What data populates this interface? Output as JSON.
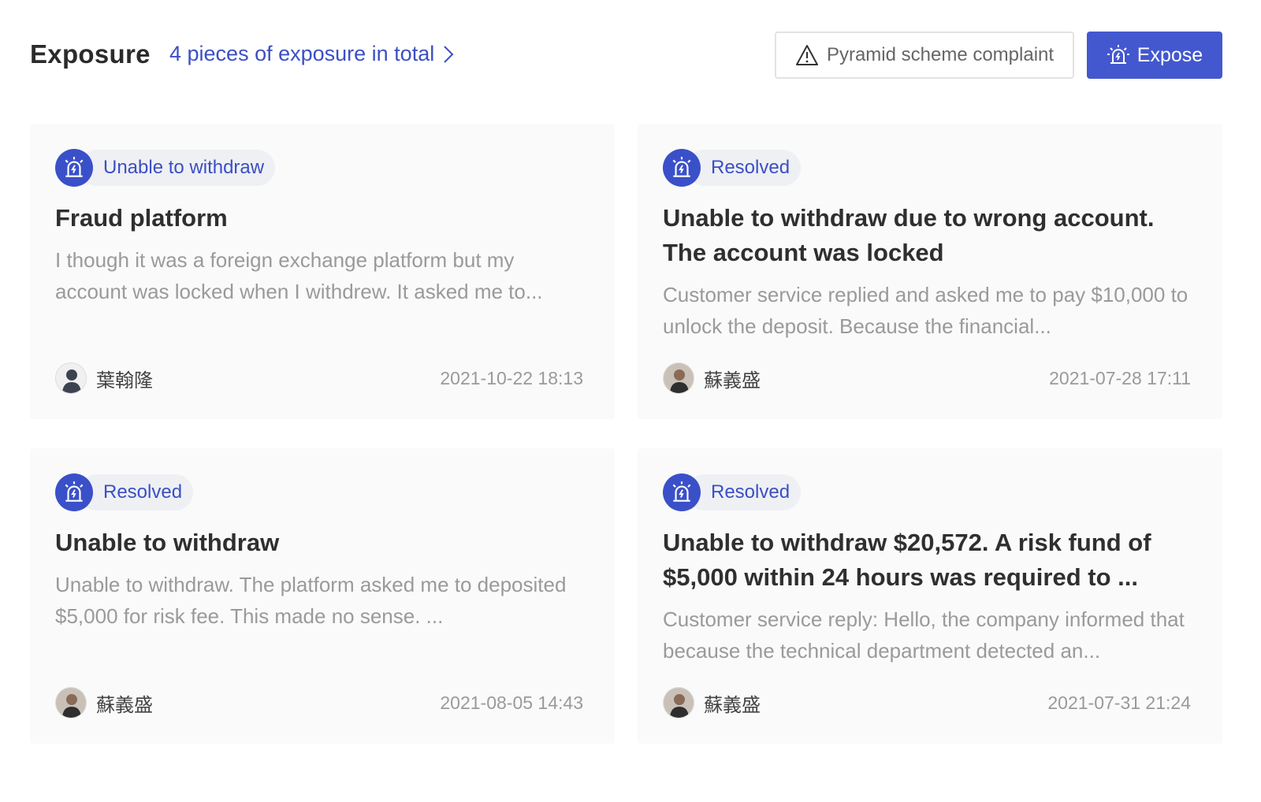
{
  "header": {
    "title": "Exposure",
    "total_link": "4 pieces of exposure in total",
    "complaint_button": "Pyramid scheme complaint",
    "expose_button": "Expose"
  },
  "colors": {
    "accent": "#4358cf",
    "badge_bg": "#eef0f4",
    "card_bg": "#fafafa",
    "link": "#3b4fc4"
  },
  "icons": {
    "total_link": "chevron-right-icon",
    "complaint": "warning-triangle-icon",
    "expose": "siren-alarm-icon",
    "badge": "siren-alarm-icon"
  },
  "cards": [
    {
      "status": "Unable to withdraw",
      "title": "Fraud platform",
      "description": "I though it was a foreign exchange platform but my account was locked when I withdrew. It asked me to...",
      "author": "葉翰隆",
      "avatar": "default-user-avatar",
      "date": "2021-10-22 18:13"
    },
    {
      "status": "Resolved",
      "title": "Unable to withdraw due to wrong account. The account was locked",
      "description": "Customer service replied and asked me to pay $10,000 to unlock the deposit. Because the financial...",
      "author": "蘇義盛",
      "avatar": "user-photo-avatar",
      "date": "2021-07-28 17:11"
    },
    {
      "status": "Resolved",
      "title": "Unable to withdraw",
      "description": "Unable to withdraw. The platform asked me to deposited $5,000 for risk fee. This made no sense. ...",
      "author": "蘇義盛",
      "avatar": "user-photo-avatar",
      "date": "2021-08-05 14:43"
    },
    {
      "status": "Resolved",
      "title": "Unable to withdraw $20,572. A risk fund of $5,000 within 24 hours was required to ...",
      "description": "Customer service reply: Hello, the company informed that because the technical department detected an...",
      "author": "蘇義盛",
      "avatar": "user-photo-avatar",
      "date": "2021-07-31 21:24"
    }
  ]
}
